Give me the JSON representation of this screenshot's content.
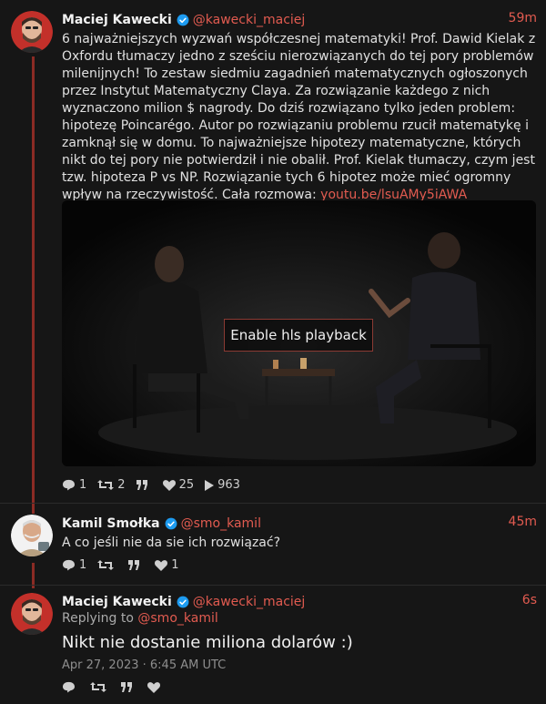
{
  "tweets": [
    {
      "fullname": "Maciej Kawecki",
      "handle": "@kawecki_maciej",
      "time": "59m",
      "text": "6 najważniejszych wyzwań współczesnej matematyki! Prof. Dawid Kielak z Oxfordu tłumaczy jedno z sześciu nierozwiązanych do tej pory problemów milenijnych! To zestaw siedmiu zagadnień matematycznych ogłoszonych przez Instytut Matematyczny Claya. Za rozwiązanie każdego z nich wyznaczono milion $ nagrody. Do dziś rozwiązano tylko jeden problem: hipotezę Poincarégo. Autor po rozwiązaniu problemu rzucił matematykę i zamknął się w domu. To najważniejsze hipotezy matematyczne, których nikt do tej pory nie potwierdził i nie obalił. Prof. Kielak tłumaczy, czym jest tzw. hipoteza P vs NP. Rozwiązanie tych 6 hipotez może mieć ogromny wpływ na rzeczywistość. Cała rozmowa:",
      "link": "youtu.be/lsuAMy5iAWA",
      "video_button": "Enable hls playback",
      "stats": {
        "replies": "1",
        "retweets": "2",
        "quotes": "",
        "likes": "25",
        "views": "963"
      }
    },
    {
      "fullname": "Kamil Smołka",
      "handle": "@smo_kamil",
      "time": "45m",
      "text": "A co jeśli nie da sie ich rozwiązać?",
      "stats": {
        "replies": "1",
        "retweets": "",
        "quotes": "",
        "likes": "1"
      }
    },
    {
      "fullname": "Maciej Kawecki",
      "handle": "@kawecki_maciej",
      "time": "6s",
      "replying_prefix": "Replying to",
      "replying_handle": "@smo_kamil",
      "text": "Nikt nie dostanie miliona dolarów :)",
      "date": "Apr 27, 2023 · 6:45 AM UTC"
    }
  ],
  "colors": {
    "background": "#161616",
    "accent": "#e25b50",
    "verified": "#1d9bf0",
    "thread": "#8b2b24"
  }
}
